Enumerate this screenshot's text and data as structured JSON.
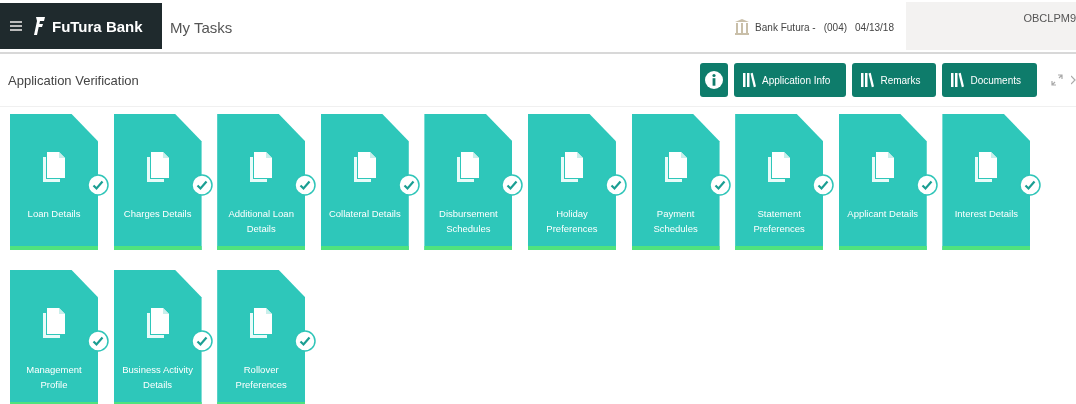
{
  "header": {
    "brand": "FuTura Bank",
    "page_title": "My Tasks",
    "branch": "Bank Futura -",
    "branch_code": "(004)",
    "date": "04/13/18",
    "user": "OBCLPM9"
  },
  "toolbar": {
    "title": "Application Verification",
    "buttons": [
      {
        "kind": "info"
      },
      {
        "kind": "labeled",
        "label": "Application Info"
      },
      {
        "kind": "labeled",
        "label": "Remarks"
      },
      {
        "kind": "labeled",
        "label": "Documents"
      }
    ]
  },
  "tiles": [
    {
      "label": "Loan Details",
      "completed": true
    },
    {
      "label": "Charges Details",
      "completed": true
    },
    {
      "label": "Additional Loan Details",
      "completed": true
    },
    {
      "label": "Collateral Details",
      "completed": true
    },
    {
      "label": "Disbursement Schedules",
      "completed": true
    },
    {
      "label": "Holiday Preferences",
      "completed": true
    },
    {
      "label": "Payment Schedules",
      "completed": true
    },
    {
      "label": "Statement Preferences",
      "completed": true
    },
    {
      "label": "Applicant Details",
      "completed": true
    },
    {
      "label": "Interest Details",
      "completed": true
    },
    {
      "label": "Management Profile",
      "completed": true
    },
    {
      "label": "Business Activity Details",
      "completed": true
    },
    {
      "label": "Rollover Preferences",
      "completed": true
    }
  ]
}
